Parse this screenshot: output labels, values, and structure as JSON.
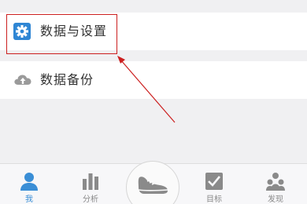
{
  "list": {
    "settings": {
      "label": "数据与设置",
      "icon": "gear-icon"
    },
    "backup": {
      "label": "数据备份",
      "icon": "cloud-upload-icon"
    }
  },
  "tabbar": {
    "tabs": [
      {
        "label": "我",
        "icon": "person-icon",
        "active": true
      },
      {
        "label": "分析",
        "icon": "bar-chart-icon",
        "active": false
      },
      {
        "label": "目标",
        "icon": "checkbox-icon",
        "active": false
      },
      {
        "label": "发现",
        "icon": "people-cluster-icon",
        "active": false
      }
    ],
    "center_icon": "shoe-icon"
  },
  "colors": {
    "accent": "#3a8ed6",
    "inactive": "#8a8a8a",
    "annotation_red": "#cc1f1f"
  }
}
